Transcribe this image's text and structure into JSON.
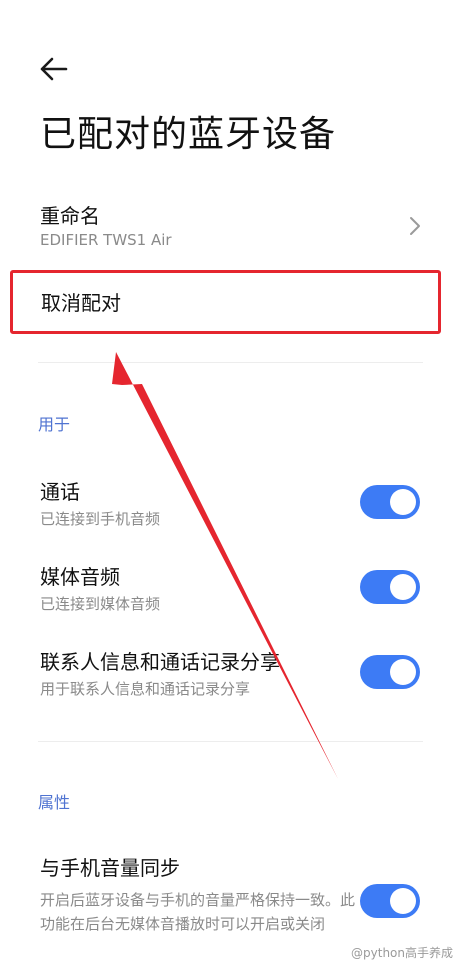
{
  "header": {
    "back_icon": "arrow-left-icon",
    "title": "已配对的蓝牙设备"
  },
  "rename": {
    "label": "重命名",
    "device_name": "EDIFIER TWS1 Air",
    "chevron_icon": "chevron-right-icon"
  },
  "unpair": {
    "label": "取消配对",
    "highlight_color": "#e5262f"
  },
  "sections": {
    "used_for": {
      "header": "用于",
      "items": [
        {
          "title": "通话",
          "subtitle": "已连接到手机音频",
          "enabled": true
        },
        {
          "title": "媒体音频",
          "subtitle": "已连接到媒体音频",
          "enabled": true
        },
        {
          "title": "联系人信息和通话记录分享",
          "subtitle": "用于联系人信息和通话记录分享",
          "enabled": true
        }
      ]
    },
    "properties": {
      "header": "属性",
      "items": [
        {
          "title": "与手机音量同步",
          "subtitle": "开启后蓝牙设备与手机的音量严格保持一致。此功能在后台无媒体音播放时可以开启或关闭",
          "enabled": true
        }
      ]
    }
  },
  "colors": {
    "accent": "#3d7bf5",
    "section_header": "#4f73d1",
    "annotation_arrow": "#e5262f"
  },
  "watermark": "@python高手养成"
}
